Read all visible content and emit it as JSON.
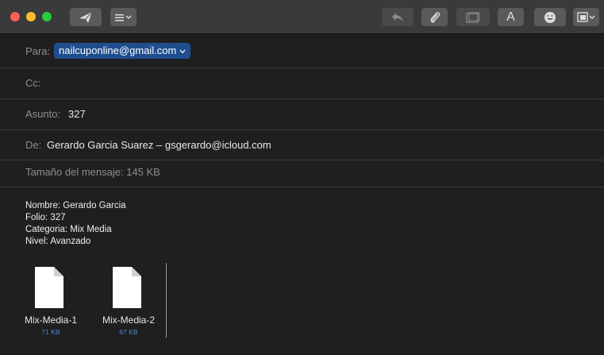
{
  "toolbar": {
    "icons": [
      "send-icon",
      "header-fields-icon",
      "reply-icon",
      "attach-icon",
      "photo-browser-icon",
      "format-icon",
      "emoji-icon",
      "media-icon"
    ],
    "format_label": "A"
  },
  "header": {
    "to_label": "Para:",
    "to_value": "nailcuponline@gmail.com",
    "cc_label": "Cc:",
    "subject_label": "Asunto:",
    "subject_value": "327",
    "from_label": "De:",
    "from_value": "Gerardo Garcia Suarez – gsgerardo@icloud.com",
    "size_text": "Tamaño del mensaje: 145 KB"
  },
  "body": {
    "lines": [
      "Nombre: Gerardo Garcia",
      "Folio: 327",
      "Categoria: Mix Media",
      "Nivel: Avanzado"
    ]
  },
  "attachments": [
    {
      "name": "Mix-Media-1",
      "size": "71 KB"
    },
    {
      "name": "Mix-Media-2",
      "size": "67 KB"
    }
  ],
  "colors": {
    "toolbar": "#3a3a3a",
    "background": "#1f1f1f",
    "accent": "#1f4e8f",
    "size_link": "#4b86d6"
  }
}
